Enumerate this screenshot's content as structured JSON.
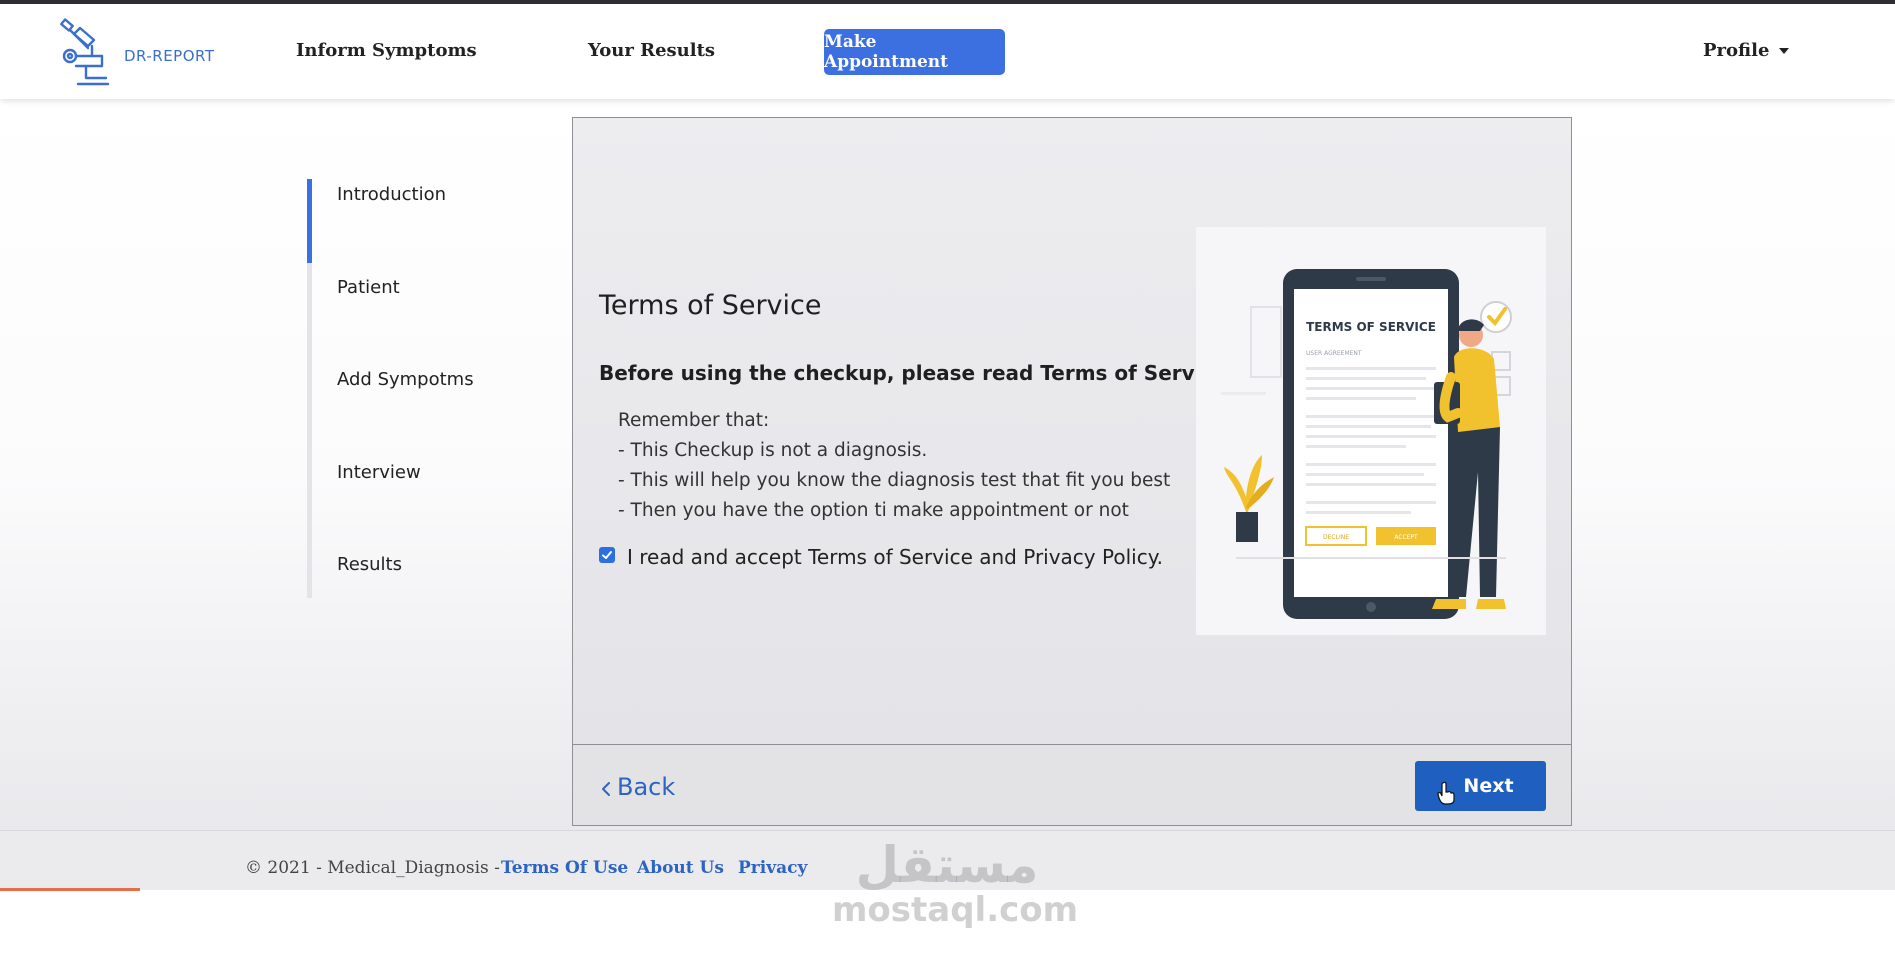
{
  "brand": {
    "logo_text": "DR-REPORT"
  },
  "nav": {
    "links": [
      "Inform Symptoms",
      "Your Results"
    ],
    "primary_label": "Make Appointment",
    "profile_label": "Profile"
  },
  "stepper": {
    "steps": [
      "Introduction",
      "Patient",
      "Add Sympotms",
      "Interview",
      "Results"
    ],
    "active_index": 0
  },
  "content": {
    "title": "Terms of Service",
    "lead": "Before using the checkup, please read Terms of Service.",
    "list": [
      "Remember that:",
      "- This Checkup is not a diagnosis.",
      "- This will help you know the diagnosis test that fit you best",
      "- Then you have the option ti make appointment or not"
    ],
    "accept_label": "I read and accept Terms of Service and Privacy Policy.",
    "accept_checked": true,
    "illustration": {
      "heading": "TERMS OF SERVICE",
      "subheading": "USER AGREEMENT",
      "decline": "DECLINE",
      "accept": "ACCEPT"
    }
  },
  "actions": {
    "back_label": "Back",
    "next_label": "Next"
  },
  "footer": {
    "copyright": "© 2021 - Medical_Diagnosis -",
    "links": [
      "Terms Of Use",
      "About Us",
      "Privacy"
    ]
  },
  "watermark": {
    "arabic": "مستقل",
    "latin": "mostaql.com"
  },
  "colors": {
    "primary": "#3c6fe0",
    "next_button": "#1f5fc0",
    "link": "#2c63c4",
    "illustration_accent": "#f2c12e"
  }
}
